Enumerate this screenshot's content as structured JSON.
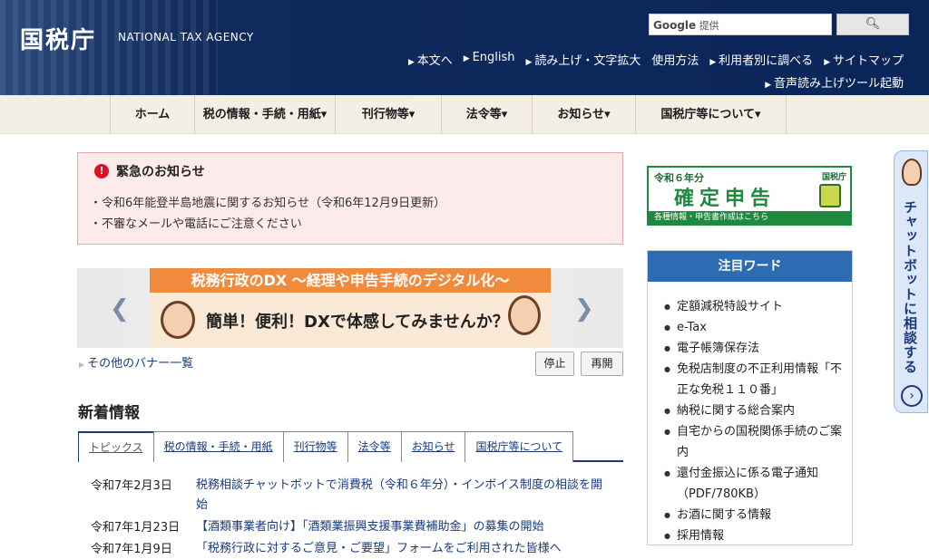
{
  "header": {
    "logo": "国税庁",
    "logo_en": "NATIONAL TAX AGENCY",
    "search_brand": "Google",
    "search_brand_suffix": "提供",
    "search_button_icon": "magnifier-icon",
    "links": [
      "本文へ",
      "English",
      "読み上げ・文字拡大",
      "使用方法",
      "利用者別に調べる",
      "サイトマップ"
    ],
    "voice_link": "音声読み上げツール起動"
  },
  "nav": {
    "items": [
      "ホーム",
      "税の情報・手続・用紙▾",
      "刊行物等▾",
      "法令等▾",
      "お知らせ▾",
      "国税庁等について▾"
    ]
  },
  "emergency": {
    "title": "緊急のお知らせ",
    "items": [
      "・令和6年能登半島地震に関するお知らせ（令和6年12月9日更新）",
      "・不審なメールや電話にご注意ください"
    ]
  },
  "banner": {
    "top": "税務行政のDX ～経理や申告手続のデジタル化～",
    "main": "簡単！便利！DXで体感してみませんか？",
    "prev_icon": "chevron-left-icon",
    "next_icon": "chevron-right-icon",
    "more": "その他のバナー一覧",
    "stop": "停止",
    "resume": "再開"
  },
  "news": {
    "heading": "新着情報",
    "tabs": [
      "トピックス",
      "税の情報・手続・用紙",
      "刊行物等",
      "法令等",
      "お知らせ",
      "国税庁等について"
    ],
    "rows": [
      {
        "date": "令和7年2月3日",
        "text": "税務相談チャットボットで消費税（令和６年分）・インボイス制度の相談を開始"
      },
      {
        "date": "令和7年1月23日",
        "text": "【酒類事業者向け】「酒類業振興支援事業費補助金」の募集の開始"
      },
      {
        "date": "令和7年1月9日",
        "text": "「税務行政に対するご意見・ご要望」フォームをご利用された皆様へ"
      }
    ]
  },
  "kakutei": {
    "year": "令和６年分",
    "title": "確定申告",
    "sub": "各種情報・申告書作成はこちら",
    "brand": "国税庁"
  },
  "chumoku": {
    "heading": "注目ワード",
    "items": [
      "定額減税特設サイト",
      "e-Tax",
      "電子帳簿保存法",
      "免税店制度の不正利用情報「不正な免税１１０番」",
      "納税に関する総合案内",
      "自宅からの国税関係手続のご案内",
      "還付金振込に係る電子通知（PDF/780KB）",
      "お酒に関する情報",
      "採用情報"
    ]
  },
  "chatbot": {
    "label": "チャットボットに相談する",
    "arrow": "›"
  }
}
